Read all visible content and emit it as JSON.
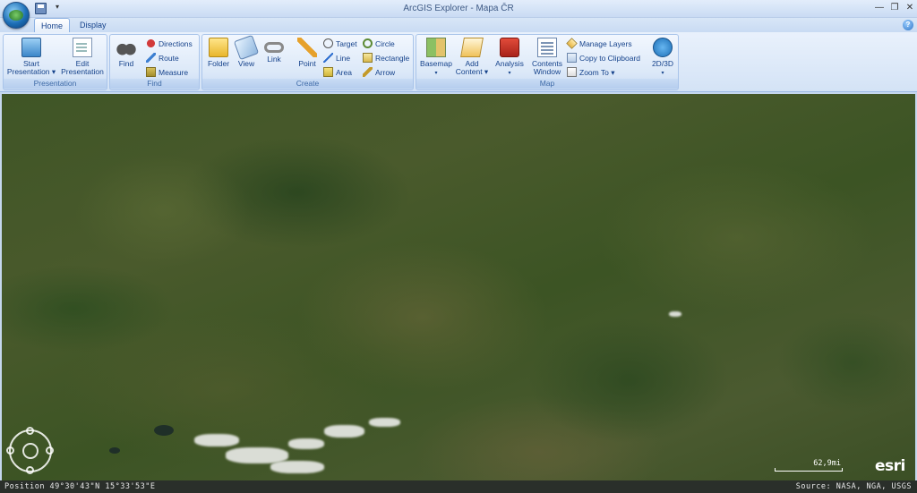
{
  "window": {
    "title": "ArcGIS Explorer - Mapa ČR",
    "minimize": "—",
    "restore": "❐",
    "close": "✕"
  },
  "quick_access": {
    "dropdown": "▾"
  },
  "tabs": [
    {
      "label": "Home",
      "active": true
    },
    {
      "label": "Display",
      "active": false
    }
  ],
  "help": "?",
  "ribbon": {
    "presentation": {
      "label": "Presentation",
      "start_line1": "Start",
      "start_line2": "Presentation ▾",
      "edit_line1": "Edit",
      "edit_line2": "Presentation"
    },
    "find": {
      "label": "Find",
      "find": "Find",
      "directions": "Directions",
      "route": "Route",
      "measure": "Measure"
    },
    "create": {
      "label": "Create",
      "folder": "Folder",
      "view": "View",
      "link": "Link",
      "point": "Point",
      "target": "Target",
      "line": "Line",
      "area": "Area",
      "circle": "Circle",
      "rectangle": "Rectangle",
      "arrow": "Arrow"
    },
    "map": {
      "label": "Map",
      "basemap": "Basemap",
      "basemap_caret": "▾",
      "add_line1": "Add",
      "add_line2": "Content ▾",
      "analysis": "Analysis",
      "analysis_caret": "▾",
      "contents_line1": "Contents",
      "contents_line2": "Window",
      "manage_layers": "Manage Layers",
      "copy_clipboard": "Copy to Clipboard",
      "zoom_to": "Zoom To ▾",
      "view_mode": "2D/3D",
      "view_mode_caret": "▾"
    }
  },
  "map": {
    "scale_label": "62,9mi",
    "logo_text": "esri"
  },
  "status": {
    "position": "Position 49°30'43\"N  15°33'53\"E",
    "source": "Source: NASA, NGA, USGS"
  }
}
